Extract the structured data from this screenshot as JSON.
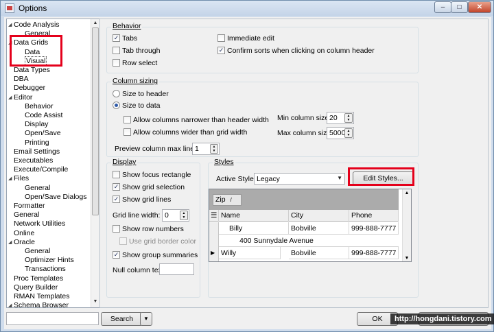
{
  "window": {
    "title": "Options",
    "minimize": "–",
    "maximize": "□",
    "close": "✕"
  },
  "tree": {
    "items": [
      {
        "label": "Code Analysis",
        "level": 0,
        "expander": "◢"
      },
      {
        "label": "General",
        "level": 1
      },
      {
        "label": "Data Grids",
        "level": 0,
        "expander": "◢"
      },
      {
        "label": "Data",
        "level": 1
      },
      {
        "label": "Visual",
        "level": 1,
        "selected": true
      },
      {
        "label": "Data Types",
        "level": 0
      },
      {
        "label": "DBA",
        "level": 0
      },
      {
        "label": "Debugger",
        "level": 0
      },
      {
        "label": "Editor",
        "level": 0,
        "expander": "◢"
      },
      {
        "label": "Behavior",
        "level": 1
      },
      {
        "label": "Code Assist",
        "level": 1
      },
      {
        "label": "Display",
        "level": 1
      },
      {
        "label": "Open/Save",
        "level": 1
      },
      {
        "label": "Printing",
        "level": 1
      },
      {
        "label": "Email Settings",
        "level": 0
      },
      {
        "label": "Executables",
        "level": 0
      },
      {
        "label": "Execute/Compile",
        "level": 0
      },
      {
        "label": "Files",
        "level": 0,
        "expander": "◢"
      },
      {
        "label": "General",
        "level": 1
      },
      {
        "label": "Open/Save Dialogs",
        "level": 1
      },
      {
        "label": "Formatter",
        "level": 0
      },
      {
        "label": "General",
        "level": 0
      },
      {
        "label": "Network Utilities",
        "level": 0
      },
      {
        "label": "Online",
        "level": 0
      },
      {
        "label": "Oracle",
        "level": 0,
        "expander": "◢"
      },
      {
        "label": "General",
        "level": 1
      },
      {
        "label": "Optimizer Hints",
        "level": 1
      },
      {
        "label": "Transactions",
        "level": 1
      },
      {
        "label": "Proc Templates",
        "level": 0
      },
      {
        "label": "Query Builder",
        "level": 0
      },
      {
        "label": "RMAN Templates",
        "level": 0
      },
      {
        "label": "Schema Browser",
        "level": 0,
        "expander": "◢"
      }
    ]
  },
  "behavior": {
    "title": "Behavior",
    "tabs": {
      "label": "Tabs",
      "checked": true
    },
    "tab_through": {
      "label": "Tab through",
      "checked": false
    },
    "row_select": {
      "label": "Row select",
      "checked": false
    },
    "immediate_edit": {
      "label": "Immediate edit",
      "checked": false
    },
    "confirm_sorts": {
      "label": "Confirm sorts when clicking on column header",
      "checked": true
    }
  },
  "column_sizing": {
    "title": "Column sizing",
    "size_to_header": "Size to header",
    "size_to_data": "Size to data",
    "allow_narrower": "Allow columns narrower than header width",
    "allow_wider": "Allow columns wider than grid width",
    "min_label": "Min column size:",
    "min_value": "20",
    "max_label": "Max column size:",
    "max_value": "5000",
    "preview_label": "Preview column max lines:",
    "preview_value": "1"
  },
  "display": {
    "title": "Display",
    "show_focus_rect": {
      "label": "Show focus rectangle",
      "checked": false
    },
    "show_grid_selection": {
      "label": "Show grid selection",
      "checked": true
    },
    "show_grid_lines": {
      "label": "Show grid lines",
      "checked": true
    },
    "grid_line_width_label": "Grid line width:",
    "grid_line_width_value": "0",
    "show_row_numbers": {
      "label": "Show row numbers",
      "checked": false
    },
    "use_grid_border_color": {
      "label": "Use grid border color",
      "checked": false
    },
    "show_group_summaries": {
      "label": "Show group summaries",
      "checked": true
    },
    "null_text_label": "Null column text:",
    "null_text_value": ""
  },
  "styles": {
    "title": "Styles",
    "active_style_label": "Active Style:",
    "active_style_value": "Legacy",
    "edit_styles_button": "Edit Styles...",
    "preview": {
      "group_chip": "Zip",
      "chip_glyph": "/",
      "columns": [
        "Name",
        "City",
        "Phone"
      ],
      "rows": [
        {
          "name": "Billy",
          "city": "Bobville",
          "phone": "999-888-7777",
          "address": "400 Sunnydale Avenue"
        },
        {
          "name": "Willy",
          "city": "Bobville",
          "phone": "999-888-7777"
        }
      ]
    }
  },
  "bottom": {
    "search_placeholder": "",
    "search_button": "Search",
    "dropdown_glyph": "▼",
    "ok_button": "OK",
    "watermark": "http://hongdani.tistory.com"
  },
  "colors": {
    "highlight_box": "#e4001b",
    "window_frame": "#cfdcec"
  }
}
